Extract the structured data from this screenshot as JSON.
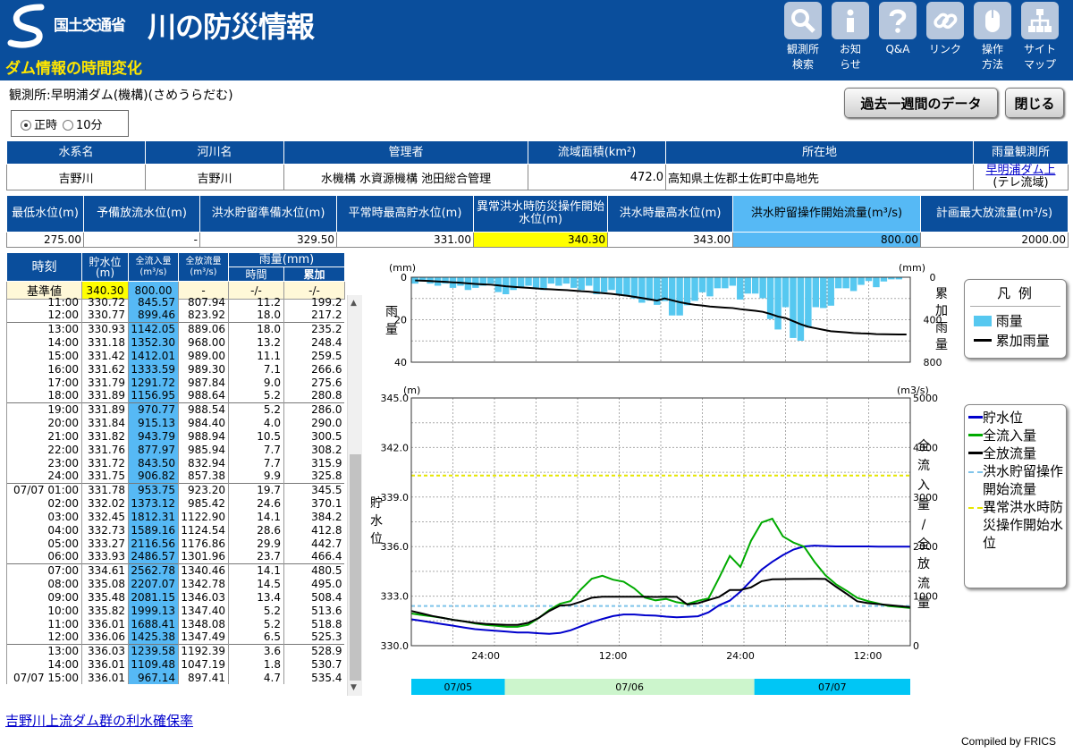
{
  "header": {
    "ministry": "国土交通省",
    "site_title": "川の防災情報",
    "page_subtitle": "ダム情報の時間変化",
    "nav": [
      {
        "label": "観測所検索",
        "l1": "観測所",
        "l2": "検索",
        "icon": "magnifier-icon"
      },
      {
        "label": "お知らせ",
        "l1": "お知",
        "l2": "らせ",
        "icon": "info-icon"
      },
      {
        "label": "Q&A",
        "l1": "Q&A",
        "l2": "",
        "icon": "question-icon"
      },
      {
        "label": "リンク",
        "l1": "リンク",
        "l2": "",
        "icon": "link-icon"
      },
      {
        "label": "操作方法",
        "l1": "操作",
        "l2": "方法",
        "icon": "mouse-icon"
      },
      {
        "label": "サイトマップ",
        "l1": "サイト",
        "l2": "マップ",
        "icon": "sitemap-icon"
      }
    ]
  },
  "station": {
    "label": "観測所:",
    "name": "早明浦ダム(機構)(さめうらだむ)"
  },
  "buttons": {
    "week": "過去一週間のデータ",
    "close": "閉じる"
  },
  "radio": {
    "opt1": "正時",
    "opt2": "10分",
    "selected": "正時"
  },
  "info": {
    "headers": [
      "水系名",
      "河川名",
      "管理者",
      "流域面積(km²)",
      "所在地",
      "雨量観測所"
    ],
    "system": "吉野川",
    "river": "吉野川",
    "manager": "水機構 水資源機構 池田総合管理",
    "area": "472.0",
    "location": "高知県土佐郡土佐町中島地先",
    "rain_station": "早明浦ダム上",
    "rain_station_note": "(テレ流域)"
  },
  "levels": {
    "headers": [
      "最低水位(m)",
      "予備放流水位(m)",
      "洪水貯留準備水位(m)",
      "平常時最高貯水位(m)",
      "異常洪水時防災操作開始水位(m)",
      "洪水時最高水位(m)",
      "洪水貯留操作開始流量(m³/s)",
      "計画最大放流量(m³/s)"
    ],
    "values": [
      "275.00",
      "-",
      "329.50",
      "331.00",
      "340.30",
      "343.00",
      "800.00",
      "2000.00"
    ]
  },
  "datatable": {
    "h_time": "時刻",
    "h_level": "貯水位",
    "h_level_unit": "(m)",
    "h_inflow": "全流入量",
    "h_inflow_unit": "(m³/s)",
    "h_outflow": "全放流量",
    "h_outflow_unit": "(m³/s)",
    "h_rain": "雨量(mm)",
    "h_rain_hour": "時間",
    "h_rain_cum": "累加",
    "base_label": "基準値",
    "base_level": "340.30",
    "base_inflow": "800.00",
    "base_outflow": "-",
    "base_hour": "-/-",
    "base_cum": "-/-",
    "rows": [
      {
        "t": "11:00",
        "lv": "330.72",
        "in": "845.57",
        "out": "807.94",
        "r": "11.2",
        "cr": "199.2"
      },
      {
        "t": "12:00",
        "lv": "330.77",
        "in": "899.46",
        "out": "823.92",
        "r": "18.0",
        "cr": "217.2"
      },
      {
        "t": "13:00",
        "lv": "330.93",
        "in": "1142.05",
        "out": "889.06",
        "r": "18.0",
        "cr": "235.2"
      },
      {
        "t": "14:00",
        "lv": "331.18",
        "in": "1352.30",
        "out": "968.00",
        "r": "13.2",
        "cr": "248.4"
      },
      {
        "t": "15:00",
        "lv": "331.42",
        "in": "1412.01",
        "out": "989.00",
        "r": "11.1",
        "cr": "259.5"
      },
      {
        "t": "16:00",
        "lv": "331.62",
        "in": "1333.59",
        "out": "989.30",
        "r": "7.1",
        "cr": "266.6"
      },
      {
        "t": "17:00",
        "lv": "331.79",
        "in": "1291.72",
        "out": "987.84",
        "r": "9.0",
        "cr": "275.6"
      },
      {
        "t": "18:00",
        "lv": "331.89",
        "in": "1156.95",
        "out": "988.64",
        "r": "5.2",
        "cr": "280.8"
      },
      {
        "t": "19:00",
        "lv": "331.89",
        "in": "970.77",
        "out": "988.54",
        "r": "5.2",
        "cr": "286.0"
      },
      {
        "t": "20:00",
        "lv": "331.84",
        "in": "915.13",
        "out": "984.40",
        "r": "4.0",
        "cr": "290.0"
      },
      {
        "t": "21:00",
        "lv": "331.82",
        "in": "943.79",
        "out": "988.94",
        "r": "10.5",
        "cr": "300.5"
      },
      {
        "t": "22:00",
        "lv": "331.76",
        "in": "877.97",
        "out": "985.94",
        "r": "7.7",
        "cr": "308.2"
      },
      {
        "t": "23:00",
        "lv": "331.72",
        "in": "843.50",
        "out": "832.94",
        "r": "7.7",
        "cr": "315.9"
      },
      {
        "t": "24:00",
        "lv": "331.75",
        "in": "906.82",
        "out": "857.38",
        "r": "9.9",
        "cr": "325.8"
      },
      {
        "t": "07/07 01:00",
        "lv": "331.78",
        "in": "953.75",
        "out": "923.20",
        "r": "19.7",
        "cr": "345.5"
      },
      {
        "t": "02:00",
        "lv": "332.02",
        "in": "1373.12",
        "out": "985.42",
        "r": "24.6",
        "cr": "370.1"
      },
      {
        "t": "03:00",
        "lv": "332.45",
        "in": "1812.31",
        "out": "1122.90",
        "r": "14.1",
        "cr": "384.2"
      },
      {
        "t": "04:00",
        "lv": "332.73",
        "in": "1589.16",
        "out": "1124.54",
        "r": "28.6",
        "cr": "412.8"
      },
      {
        "t": "05:00",
        "lv": "333.27",
        "in": "2116.56",
        "out": "1176.86",
        "r": "29.9",
        "cr": "442.7"
      },
      {
        "t": "06:00",
        "lv": "333.93",
        "in": "2486.57",
        "out": "1301.96",
        "r": "23.7",
        "cr": "466.4"
      },
      {
        "t": "07:00",
        "lv": "334.61",
        "in": "2562.78",
        "out": "1340.46",
        "r": "14.1",
        "cr": "480.5"
      },
      {
        "t": "08:00",
        "lv": "335.08",
        "in": "2207.07",
        "out": "1342.78",
        "r": "14.5",
        "cr": "495.0"
      },
      {
        "t": "09:00",
        "lv": "335.48",
        "in": "2081.15",
        "out": "1346.03",
        "r": "13.4",
        "cr": "508.4"
      },
      {
        "t": "10:00",
        "lv": "335.82",
        "in": "1999.13",
        "out": "1347.40",
        "r": "5.2",
        "cr": "513.6"
      },
      {
        "t": "11:00",
        "lv": "336.01",
        "in": "1688.41",
        "out": "1348.08",
        "r": "5.2",
        "cr": "518.8"
      },
      {
        "t": "12:00",
        "lv": "336.06",
        "in": "1425.38",
        "out": "1347.49",
        "r": "6.5",
        "cr": "525.3"
      },
      {
        "t": "13:00",
        "lv": "336.03",
        "in": "1239.58",
        "out": "1192.39",
        "r": "3.6",
        "cr": "528.9"
      },
      {
        "t": "14:00",
        "lv": "336.01",
        "in": "1109.48",
        "out": "1047.19",
        "r": "1.8",
        "cr": "530.7"
      },
      {
        "t": "07/07 15:00",
        "lv": "336.01",
        "in": "967.14",
        "out": "897.41",
        "r": "4.7",
        "cr": "535.4"
      }
    ]
  },
  "chart_data": [
    {
      "type": "bar",
      "title": "",
      "ylabel": "雨量",
      "ylabel_units": "(mm)",
      "y2label": "累加雨量",
      "y2label_units": "(mm)",
      "ylim": [
        0,
        40
      ],
      "y2lim": [
        0,
        800
      ],
      "yticks": [
        "0",
        "20",
        "40"
      ],
      "y2ticks": [
        "0",
        "400",
        "800"
      ],
      "n_points": 66,
      "series": [
        {
          "name": "雨量",
          "color": "#56c8f0",
          "values": [
            3,
            2,
            3,
            4,
            3,
            5,
            4,
            6,
            5,
            4,
            3,
            7,
            8,
            6,
            5,
            4,
            5,
            6,
            3,
            4,
            3,
            5,
            6,
            4,
            8,
            7,
            6,
            8,
            9,
            10,
            12,
            11,
            13,
            11.2,
            18,
            18,
            13.2,
            11.1,
            7.1,
            9,
            5.2,
            5.2,
            4,
            10.5,
            7.7,
            7.7,
            9.9,
            19.7,
            24.6,
            14.1,
            28.6,
            29.9,
            23.7,
            14.1,
            14.5,
            13.4,
            5.2,
            5.2,
            6.5,
            3.6,
            1.8,
            4.7,
            2,
            1,
            1,
            0
          ]
        },
        {
          "name": "累加雨量",
          "color": "#000000",
          "values": [
            30,
            33,
            36,
            40,
            43,
            48,
            52,
            58,
            63,
            67,
            70,
            77,
            85,
            91,
            96,
            100,
            105,
            111,
            114,
            118,
            121,
            126,
            132,
            136,
            144,
            151,
            157,
            165,
            174,
            184,
            196,
            207,
            220,
            199.2,
            217.2,
            235.2,
            248.4,
            259.5,
            266.6,
            275.6,
            280.8,
            286,
            290,
            300.5,
            308.2,
            315.9,
            325.8,
            345.5,
            370.1,
            384.2,
            412.8,
            442.7,
            466.4,
            480.5,
            495,
            508.4,
            513.6,
            518.8,
            525.3,
            528.9,
            530.7,
            535.4,
            537,
            538,
            539,
            539
          ]
        }
      ],
      "legend": {
        "title": "凡 例",
        "items": [
          "雨量",
          "累加雨量"
        ]
      }
    },
    {
      "type": "line",
      "title": "",
      "ylabel": "貯水位",
      "ylabel_units": "(m)",
      "y2label": "全流入量/全放流量",
      "y2label_units": "(m3/s)",
      "ylim": [
        330,
        345
      ],
      "y2lim": [
        0,
        5000
      ],
      "yticks": [
        "345.0",
        "342.0",
        "339.0",
        "336.0",
        "333.0",
        "330.0"
      ],
      "y2ticks": [
        "5000",
        "4000",
        "3000",
        "2000",
        "1000",
        "0"
      ],
      "xticks": [
        "24:00",
        "12:00",
        "24:00",
        "12:00"
      ],
      "xtick_pos": [
        7,
        19,
        31,
        43
      ],
      "n_points": 48,
      "date_bands": [
        {
          "label": "07/05",
          "from": 0,
          "to": 9,
          "color": "#00c6f5"
        },
        {
          "label": "07/06",
          "from": 9,
          "to": 33,
          "color": "#ccf5cc"
        },
        {
          "label": "07/07",
          "from": 33,
          "to": 48,
          "color": "#00c6f5"
        }
      ],
      "series": [
        {
          "name": "貯水位",
          "axis": "left",
          "color": "#0000cc",
          "values": [
            331.6,
            331.5,
            331.4,
            331.3,
            331.2,
            331.1,
            331.0,
            330.95,
            330.9,
            330.85,
            330.8,
            330.8,
            330.75,
            330.72,
            330.77,
            330.93,
            331.18,
            331.42,
            331.62,
            331.79,
            331.89,
            331.89,
            331.84,
            331.82,
            331.76,
            331.72,
            331.75,
            331.78,
            332.02,
            332.45,
            332.73,
            333.27,
            333.93,
            334.61,
            335.08,
            335.48,
            335.82,
            336.01,
            336.06,
            336.03,
            336.01,
            336.01,
            336.01,
            336.01,
            336.0,
            336.0,
            336.0,
            336.0
          ]
        },
        {
          "name": "全流入量",
          "axis": "right",
          "color": "#00aa00",
          "values": [
            650,
            620,
            590,
            560,
            520,
            490,
            450,
            420,
            400,
            380,
            380,
            420,
            560,
            720,
            845,
            900,
            1142,
            1352,
            1412,
            1333,
            1292,
            1157,
            971,
            915,
            944,
            878,
            843,
            907,
            954,
            1373,
            1812,
            1589,
            2117,
            2487,
            2563,
            2207,
            2081,
            1999,
            1688,
            1425,
            1240,
            1109,
            967,
            900,
            850,
            800,
            780,
            760
          ]
        },
        {
          "name": "全放流量",
          "axis": "right",
          "color": "#000000",
          "values": [
            700,
            650,
            600,
            560,
            520,
            490,
            460,
            440,
            430,
            420,
            420,
            460,
            560,
            700,
            808,
            824,
            889,
            968,
            989,
            989,
            988,
            989,
            989,
            984,
            989,
            986,
            833,
            857,
            923,
            985,
            1123,
            1125,
            1177,
            1302,
            1340,
            1343,
            1346,
            1347,
            1348,
            1347,
            1192,
            1047,
            897,
            860,
            840,
            820,
            800,
            780
          ]
        }
      ],
      "reference_lines": [
        {
          "name": "洪水貯留操作開始流量",
          "axis": "right",
          "value": 800,
          "color": "#7fc4ea"
        },
        {
          "name": "異常洪水時防災操作開始水位",
          "axis": "left",
          "value": 340.3,
          "color": "#e6e600"
        }
      ],
      "legend": {
        "items": [
          "貯水位",
          "全流入量",
          "全放流量",
          "洪水貯留操作開始流量",
          "異常洪水時防災操作開始水位"
        ]
      }
    }
  ],
  "footer": {
    "link": "吉野川上流ダム群の利水確保率",
    "compiled": "Compiled by FRICS"
  }
}
